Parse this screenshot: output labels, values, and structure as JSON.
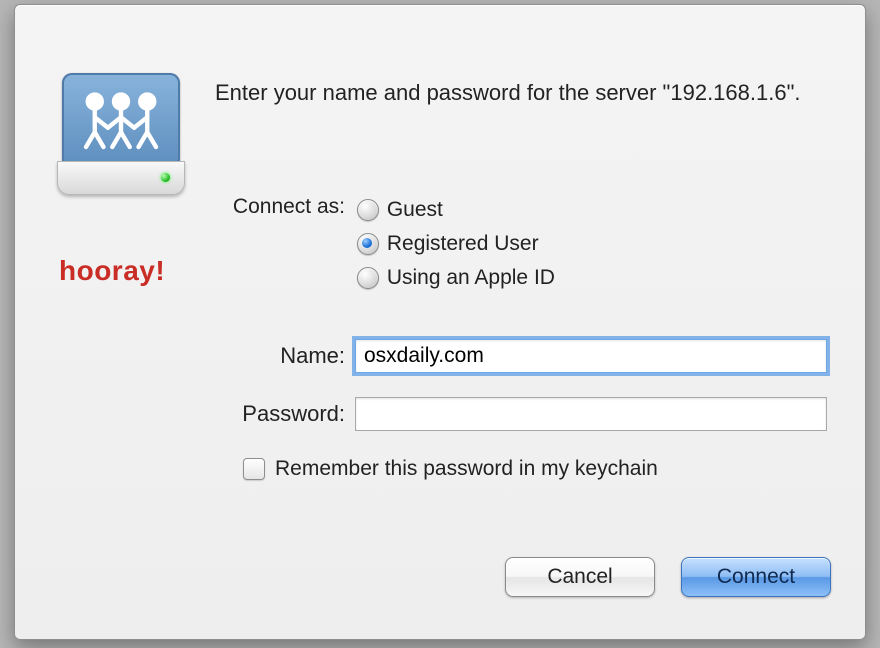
{
  "prompt": "Enter your name and password for the server \"192.168.1.6\".",
  "connect_as": {
    "label": "Connect as:",
    "options": {
      "guest": "Guest",
      "registered": "Registered User",
      "apple_id": "Using an Apple ID"
    },
    "selected": "registered"
  },
  "fields": {
    "name_label": "Name:",
    "name_value": "osxdaily.com",
    "password_label": "Password:",
    "password_value": ""
  },
  "remember_label": "Remember this password in my keychain",
  "buttons": {
    "cancel": "Cancel",
    "connect": "Connect"
  },
  "annotation": "hooray!"
}
